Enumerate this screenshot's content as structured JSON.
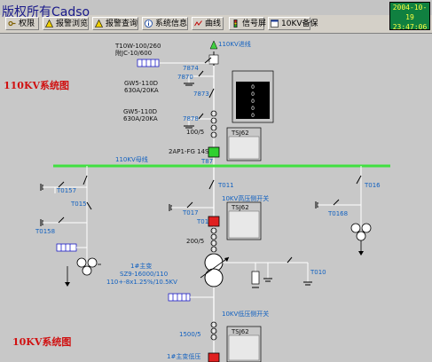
{
  "watermark": "版权所有Cadso",
  "toolbar": {
    "buttons": [
      {
        "label": "权限",
        "icon": "key-icon"
      },
      {
        "label": "报警浏览",
        "icon": "warning-icon"
      },
      {
        "label": "报警查询",
        "icon": "warning-icon"
      },
      {
        "label": "系统信息",
        "icon": "info-icon"
      },
      {
        "label": "曲线",
        "icon": "curve-icon"
      },
      {
        "label": "信号屏",
        "icon": "traffic-light-icon"
      },
      {
        "label": "10KV备保",
        "icon": "window-icon"
      }
    ]
  },
  "clock": {
    "date": "2004-10-19",
    "time": "23:47:06"
  },
  "titles": {
    "top": "110KV系统图",
    "bottom": "10KV系统图"
  },
  "labels": {
    "line_in": "110KV进线",
    "ct1": "T10W-100/260",
    "ct1b": "附JC-10/600",
    "sw7874": "7874",
    "sw7870": "7870",
    "gw5a": "GW5-110D",
    "gw5a_rating": "630A/20KA",
    "sw7873": "7873",
    "gw5b": "GW5-110D",
    "gw5b_rating": "630A/20KA",
    "sw7878": "7878",
    "ct_ratio1": "100/5",
    "prot_name": "2AP1-FG 14S",
    "cb_t87": "T87",
    "tsj1": "TSJ62",
    "dp_title": "IQ DP4000",
    "bus": "110KV母线",
    "t0157": "T0157",
    "t015": "T015",
    "t0158": "T0158",
    "t011": "T011",
    "t017": "T017",
    "t01": "T01",
    "hv_switch": "10KV高压侧开关",
    "tsj2": "TSJ62",
    "ct_ratio2": "200/5",
    "t016": "T016",
    "t0168": "T0168",
    "xfmr_name": "1#主变",
    "xfmr_model": "SZ9-16000/110",
    "xfmr_ratio": "110+-8x1.25%/10.5KV",
    "t010": "T010",
    "lv_switch": "10KV低压侧开关",
    "ct_ratio3": "1500/5",
    "tsj3": "TSJ62",
    "lv_cb": "1#主变低压"
  },
  "dp_display": [
    "0",
    "0",
    "0",
    "0",
    "0"
  ],
  "colors": {
    "bus": "#40e040",
    "closed_breaker": "#30d030",
    "open_breaker": "#e02020",
    "title": "#d01010"
  }
}
